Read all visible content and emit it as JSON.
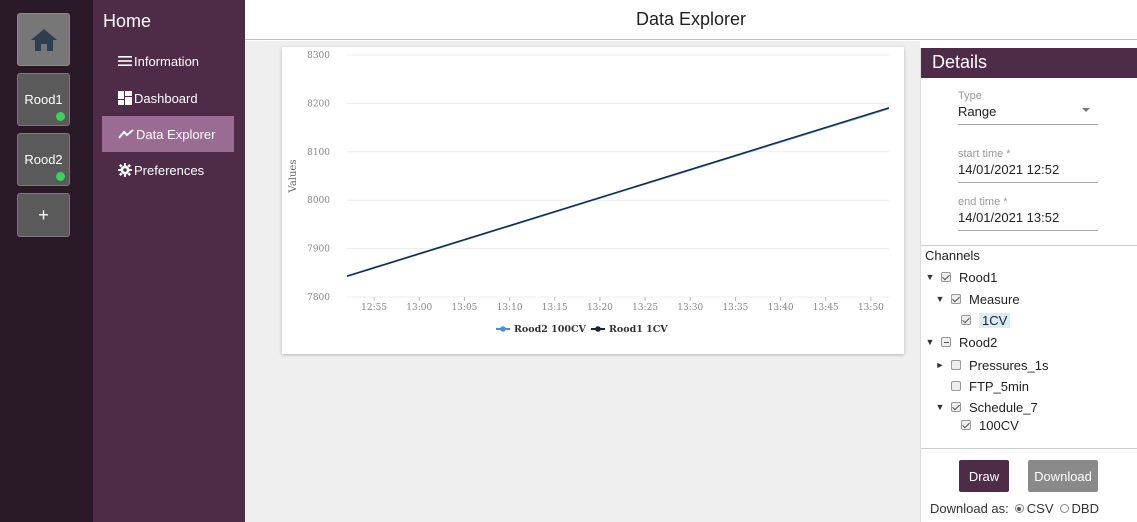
{
  "rail": {
    "items": [
      {
        "label": "Rood1"
      },
      {
        "label": "Rood2"
      }
    ],
    "add_label": "+"
  },
  "nav": {
    "title": "Home",
    "items": [
      {
        "label": "Information",
        "icon": "list-icon"
      },
      {
        "label": "Dashboard",
        "icon": "dashboard-icon"
      },
      {
        "label": "Data Explorer",
        "icon": "trend-icon",
        "active": true
      },
      {
        "label": "Preferences",
        "icon": "gear-icon"
      }
    ]
  },
  "header": {
    "title": "Data Explorer"
  },
  "chart_data": {
    "type": "line",
    "ylabel": "Values",
    "ylim": [
      7800,
      8300
    ],
    "yticks": [
      "8300",
      "8200",
      "8100",
      "8000",
      "7900",
      "7800"
    ],
    "xticks": [
      "12:55",
      "13:00",
      "13:05",
      "13:10",
      "13:15",
      "13:20",
      "13:25",
      "13:30",
      "13:35",
      "13:40",
      "13:45",
      "13:50"
    ],
    "grid": true,
    "legend_position": "bottom",
    "series": [
      {
        "name": "Rood2 100CV",
        "color": "#4a90d9",
        "x": [
          "12:52",
          "13:52"
        ],
        "values": [
          7843,
          8190
        ]
      },
      {
        "name": "Rood1 1CV",
        "color": "#1b2433",
        "x": [
          "12:52",
          "13:52"
        ],
        "values": [
          7843,
          8191
        ]
      }
    ]
  },
  "details": {
    "title": "Details",
    "type_label": "Type",
    "type_value": "Range",
    "start_label": "start time *",
    "start_value": "14/01/2021 12:52",
    "end_label": "end time *",
    "end_value": "14/01/2021 13:52",
    "channels_title": "Channels",
    "tree": [
      {
        "label": "Rood1"
      },
      {
        "label": "Measure"
      },
      {
        "label": "1CV"
      },
      {
        "label": "Rood2"
      },
      {
        "label": "Pressures_1s"
      },
      {
        "label": "FTP_5min"
      },
      {
        "label": "Schedule_7"
      },
      {
        "label": "100CV"
      }
    ],
    "draw_label": "Draw",
    "download_label": "Download",
    "download_as_label": "Download as:",
    "formats": [
      "CSV",
      "DBD"
    ],
    "selected_format": "CSV"
  },
  "colors": {
    "accent": "#4e2c48",
    "nav_bg": "#4e2c48",
    "rail_bg": "#2a1a28",
    "active_item": "#9a6b93",
    "status_online": "#3bd45a"
  }
}
